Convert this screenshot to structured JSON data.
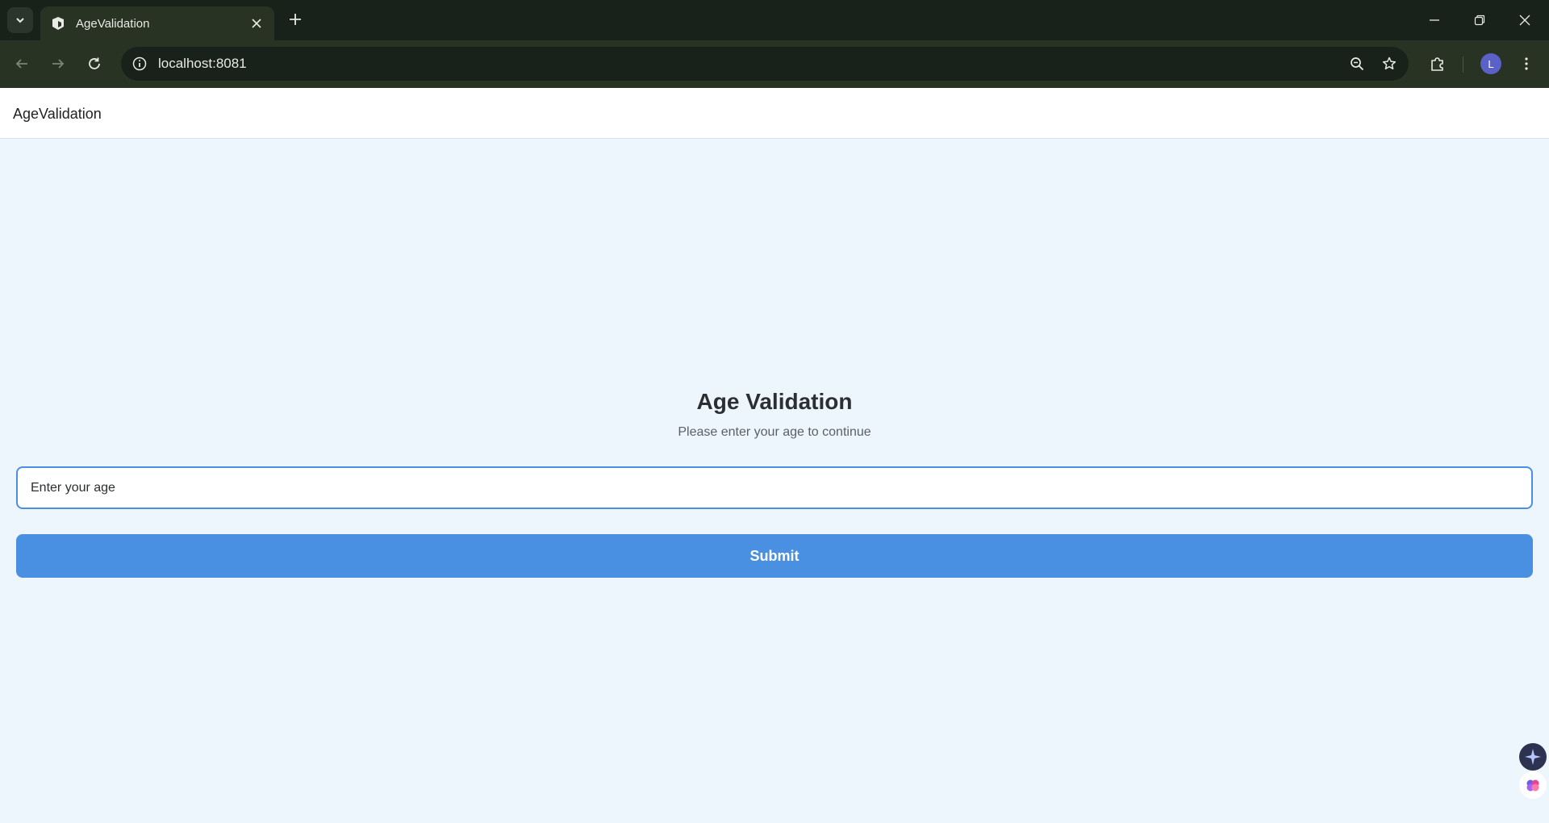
{
  "browser": {
    "tab_title": "AgeValidation",
    "url": "localhost:8081",
    "profile_initial": "L"
  },
  "app": {
    "header_title": "AgeValidation"
  },
  "form": {
    "title": "Age Validation",
    "subtitle": "Please enter your age to continue",
    "age_placeholder": "Enter your age",
    "submit_label": "Submit"
  },
  "colors": {
    "accent": "#4a90e2",
    "page_background": "#eef6fd",
    "chrome_dark": "#18221a",
    "chrome_toolbar": "#293324"
  },
  "icons": {
    "tab_search": "chevron-down-icon",
    "favicon": "app-favicon-icon",
    "tab_close": "close-icon",
    "new_tab": "plus-icon",
    "minimize": "minimize-icon",
    "restore": "restore-icon",
    "close_window": "close-icon",
    "back": "arrow-left-icon",
    "forward": "arrow-right-icon",
    "reload": "reload-icon",
    "site_info": "info-icon",
    "zoom": "zoom-out-icon",
    "bookmark": "star-icon",
    "extensions": "puzzle-icon",
    "menu": "more-vertical-icon"
  }
}
